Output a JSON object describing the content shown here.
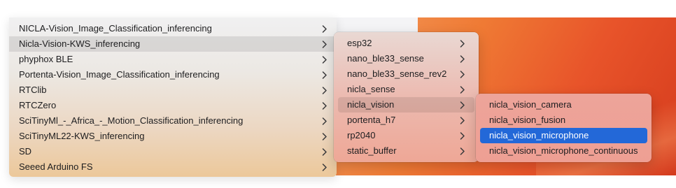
{
  "menu_level1": {
    "items": [
      {
        "label": "NICLA-Vision_Image_Classification_inferencing",
        "state": "normal"
      },
      {
        "label": "Nicla-Vision-KWS_inferencing",
        "state": "hover"
      },
      {
        "label": "phyphox BLE",
        "state": "normal"
      },
      {
        "label": "Portenta-Vision_Image_Classification_inferencing",
        "state": "normal"
      },
      {
        "label": "RTClib",
        "state": "normal"
      },
      {
        "label": "RTCZero",
        "state": "normal"
      },
      {
        "label": "SciTinyMl_-_Africa_-_Motion_Classification_inferencing",
        "state": "normal"
      },
      {
        "label": "SciTinyML22-KWS_inferencing",
        "state": "normal"
      },
      {
        "label": "SD",
        "state": "normal"
      },
      {
        "label": "Seeed Arduino FS",
        "state": "normal"
      }
    ]
  },
  "menu_level2": {
    "items": [
      {
        "label": "esp32",
        "state": "normal"
      },
      {
        "label": "nano_ble33_sense",
        "state": "normal"
      },
      {
        "label": "nano_ble33_sense_rev2",
        "state": "normal"
      },
      {
        "label": "nicla_sense",
        "state": "normal"
      },
      {
        "label": "nicla_vision",
        "state": "hover"
      },
      {
        "label": "portenta_h7",
        "state": "normal"
      },
      {
        "label": "rp2040",
        "state": "normal"
      },
      {
        "label": "static_buffer",
        "state": "normal"
      }
    ]
  },
  "menu_level3": {
    "items": [
      {
        "label": "nicla_vision_camera",
        "state": "normal"
      },
      {
        "label": "nicla_vision_fusion",
        "state": "normal"
      },
      {
        "label": "nicla_vision_microphone",
        "state": "selected"
      },
      {
        "label": "nicla_vision_microphone_continuous",
        "state": "normal"
      }
    ]
  },
  "icons": {
    "submenu": "chevron-right-icon"
  },
  "colors": {
    "selection": "#2368d8",
    "text": "#1d1d1f"
  }
}
